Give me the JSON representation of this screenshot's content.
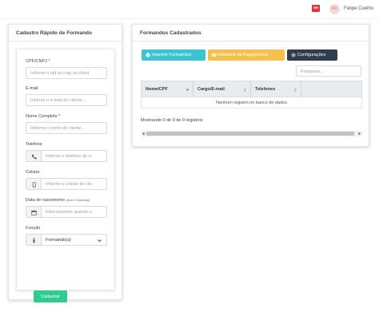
{
  "topbar": {
    "flag_text": "BR",
    "avatar_initials": "FC",
    "user_name": "Felipe Coelho"
  },
  "form_panel": {
    "title": "Cadastro Rápido de Formando",
    "fields": {
      "cpf": {
        "label": "CPF/CNPJ *",
        "placeholder": "Informe o cpf ou cnpj do client"
      },
      "email": {
        "label": "E-mail",
        "placeholder": "Informe o e-mail do cliente..."
      },
      "name": {
        "label": "Nome Completo *",
        "placeholder": "Informe o nome do cliente..."
      },
      "phone": {
        "label": "Telefone",
        "placeholder": "Informe o telefone do cl",
        "icon": "phone-icon"
      },
      "mobile": {
        "label": "Celular",
        "placeholder": "Informe o celular do clie",
        "icon": "mobile-icon"
      },
      "birth": {
        "label": "Data de nascimento",
        "hint": "(Ano é Opcional)",
        "placeholder": "Informaremos quando o",
        "icon": "calendar-icon"
      },
      "role": {
        "label": "Função",
        "value": "Formando(a)",
        "icon": "person-icon"
      }
    },
    "submit_label": "Cadastrar"
  },
  "list_panel": {
    "title": "Formandos Cadastrados",
    "buttons": {
      "print": "Imprimir Formandos",
      "report": "Relatório de Pagamentos",
      "config": "Configurações"
    },
    "search_placeholder": "Pesquisar...",
    "columns": [
      "Nome/CPF",
      "Cargo/E-mail",
      "Telefones"
    ],
    "empty_message": "Nenhum registro no banco de dados",
    "info": "Mostrando 0 de 0 de 0 registros"
  },
  "colors": {
    "accent_green": "#2ecc8f",
    "print_btn": "#3cc3d1",
    "report_btn": "#f2c14e",
    "config_btn": "#2f3e4e"
  }
}
